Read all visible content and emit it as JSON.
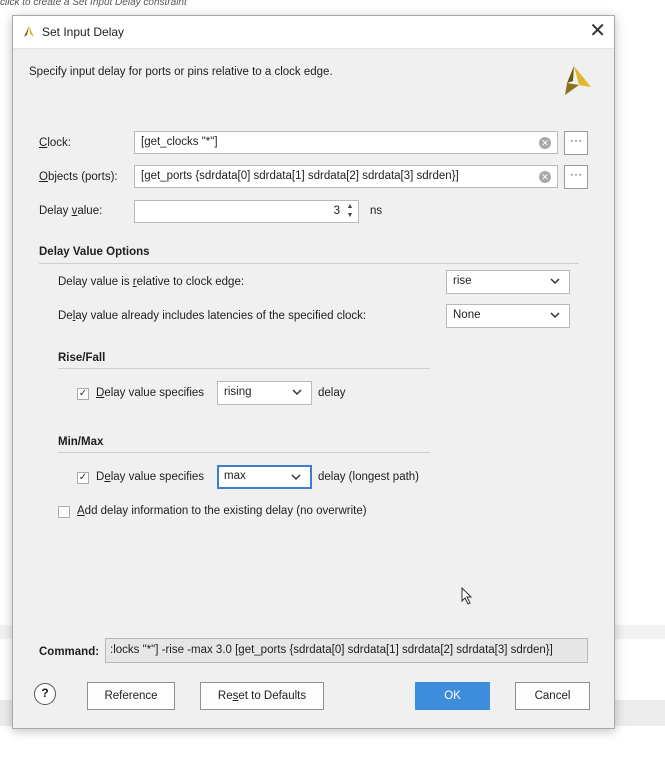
{
  "background_hint": "click to create a Set Input Delay constraint",
  "dialog": {
    "title": "Set Input Delay",
    "description": "Specify input delay for ports or pins relative to a clock edge."
  },
  "form": {
    "clock": {
      "label_pre": "",
      "label_underline": "C",
      "label_post": "lock:",
      "value": "[get_clocks \"*\"]"
    },
    "objects": {
      "label_pre": "",
      "label_underline": "O",
      "label_post": "bjects (ports):",
      "value": "[get_ports {sdrdata[0] sdrdata[1] sdrdata[2] sdrdata[3] sdrden}]"
    },
    "delay_value": {
      "label_pre": "Delay ",
      "label_underline": "v",
      "label_post": "alue:",
      "value": "3",
      "unit": "ns"
    }
  },
  "options": {
    "title": "Delay Value Options",
    "relative_edge": {
      "label_pre": "Delay value is ",
      "label_underline": "r",
      "label_post": "elative to clock edge:",
      "value": "rise"
    },
    "latencies": {
      "label_pre": "De",
      "label_underline": "l",
      "label_post": "ay value already includes latencies of the specified clock:",
      "value": "None"
    }
  },
  "rise_fall": {
    "title": "Rise/Fall",
    "checked": true,
    "label_pre": "",
    "label_underline": "D",
    "label_post": "elay value specifies",
    "value": "rising",
    "suffix": "delay"
  },
  "min_max": {
    "title": "Min/Max",
    "checked": true,
    "label_pre": "D",
    "label_underline": "e",
    "label_post": "lay value specifies",
    "value": "max",
    "suffix": "delay (longest path)"
  },
  "add_delay": {
    "checked": false,
    "label_pre": "",
    "label_underline": "A",
    "label_post": "dd delay information to the existing delay (no overwrite)"
  },
  "command": {
    "label": "Command:",
    "value": ":locks \"*\"] -rise -max 3.0 [get_ports {sdrdata[0] sdrdata[1] sdrdata[2] sdrdata[3] sdrden}]"
  },
  "buttons": {
    "help": "?",
    "reference": "Reference",
    "reset_pre": "Re",
    "reset_underline": "s",
    "reset_post": "et to Defaults",
    "ok": "OK",
    "cancel": "Cancel"
  },
  "icons": {
    "title_icon": "vivado-logo-icon",
    "close": "close-icon",
    "logo": "vivado-logo-icon",
    "clear": "clear-circle-icon",
    "more": "ellipsis-icon",
    "spin": "spinner-icon",
    "chevron": "chevron-down-icon",
    "check": "checkmark-icon",
    "cursor": "mouse-pointer-icon"
  },
  "colors": {
    "primary_button": "#3d8ddc",
    "focus_border": "#3c7fd1",
    "logo_dark": "#6a5a14",
    "logo_light": "#e0b82a"
  }
}
